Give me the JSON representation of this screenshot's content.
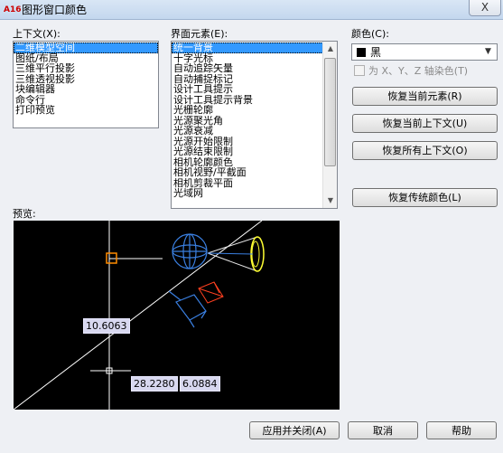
{
  "window": {
    "title": "图形窗口颜色",
    "app_icon_text": "A16",
    "close_glyph": "X"
  },
  "context": {
    "label": "上下文(X):",
    "items": [
      "二维模型空间",
      "图纸/布局",
      "三维平行投影",
      "三维透视投影",
      "块编辑器",
      "命令行",
      "打印预览"
    ],
    "selected_index": 0
  },
  "elements": {
    "label": "界面元素(E):",
    "items": [
      "统一背景",
      "十字光标",
      "自动追踪矢量",
      "自动捕捉标记",
      "设计工具提示",
      "设计工具提示背景",
      "光栅轮廓",
      "光源聚光角",
      "光源衰减",
      "光源开始限制",
      "光源结束限制",
      "相机轮廓颜色",
      "相机视野/平截面",
      "相机剪裁平面",
      "光域网"
    ],
    "selected_index": 0
  },
  "color": {
    "label": "颜色(C):",
    "value": "黑",
    "swatch_color": "#000000"
  },
  "tint_checkbox": {
    "label": "为 X、Y、Z 轴染色(T)",
    "checked": false
  },
  "buttons": {
    "restore_element": "恢复当前元素(R)",
    "restore_context": "恢复当前上下文(U)",
    "restore_all": "恢复所有上下文(O)",
    "restore_classic": "恢复传统颜色(L)",
    "apply_close": "应用并关闭(A)",
    "cancel": "取消",
    "help": "帮助"
  },
  "preview": {
    "label": "预览:",
    "dim_vertical": "10.6063",
    "dim_horizontal": "28.2280",
    "dim_angle": "6.0884"
  }
}
